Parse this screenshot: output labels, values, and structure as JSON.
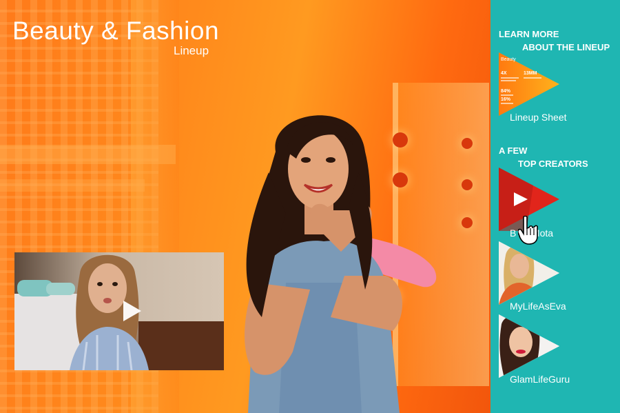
{
  "hero": {
    "title": "Beauty & Fashion",
    "subtitle": "Lineup"
  },
  "video": {
    "play_icon": "play-icon"
  },
  "sidebar": {
    "learn_more_line1": "LEARN MORE",
    "learn_more_line2": "ABOUT THE LINEUP",
    "lineup_sheet": {
      "label": "Lineup Sheet",
      "thumb_title": "Beauty",
      "stats": [
        "4X",
        "13MM",
        "84%",
        "16%"
      ]
    },
    "creators_line1": "A FEW",
    "creators_line2": "TOP CREATORS",
    "creators": [
      {
        "label": "Bethany Mota",
        "label_visible": "B      ny Mota"
      },
      {
        "label": "MyLifeAsEva"
      },
      {
        "label": "GlamLifeGuru"
      }
    ]
  },
  "colors": {
    "sidebar_bg": "#1fb6b2",
    "hero_orange": "#ff8a1c",
    "play_red": "#e1251b"
  }
}
